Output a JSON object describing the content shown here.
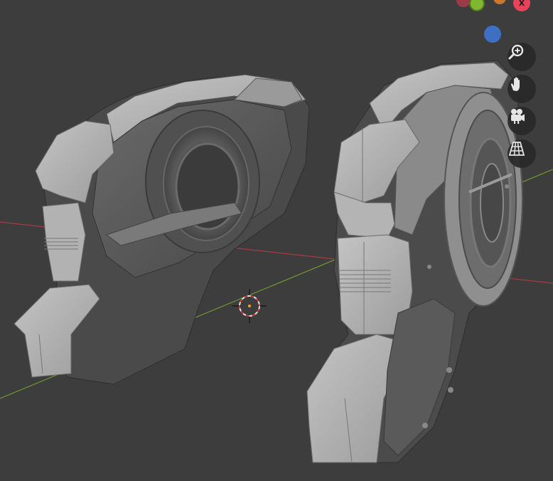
{
  "app": "Blender",
  "colors": {
    "background": "#3d3d3d",
    "axis_x": "#a83a44",
    "axis_y": "#6f9a2e",
    "mesh_light": "#b9b9b9",
    "mesh_mid": "#8d8d8d",
    "mesh_dark": "#5f5f5f",
    "gizmo_x": "#e8435a",
    "gizmo_y": "#7fb830",
    "gizmo_z": "#3f6fc2",
    "gizmo_neg_x": "#9c3a48",
    "button_bg": "#2a2a2a"
  },
  "navigation_gizmo": {
    "x_label": "X",
    "axes": [
      "x",
      "y",
      "z",
      "-x"
    ]
  },
  "nav_buttons": [
    {
      "id": "zoom",
      "icon": "magnifier-plus-icon",
      "tooltip": ""
    },
    {
      "id": "pan",
      "icon": "hand-icon",
      "tooltip": ""
    },
    {
      "id": "camera",
      "icon": "camera-icon",
      "tooltip": ""
    },
    {
      "id": "ortho",
      "icon": "grid-perspective-icon",
      "tooltip": ""
    }
  ],
  "scene": {
    "objects": [
      "left-helmet-mesh",
      "right-helmet-mesh"
    ],
    "cursor": "3d-cursor"
  }
}
